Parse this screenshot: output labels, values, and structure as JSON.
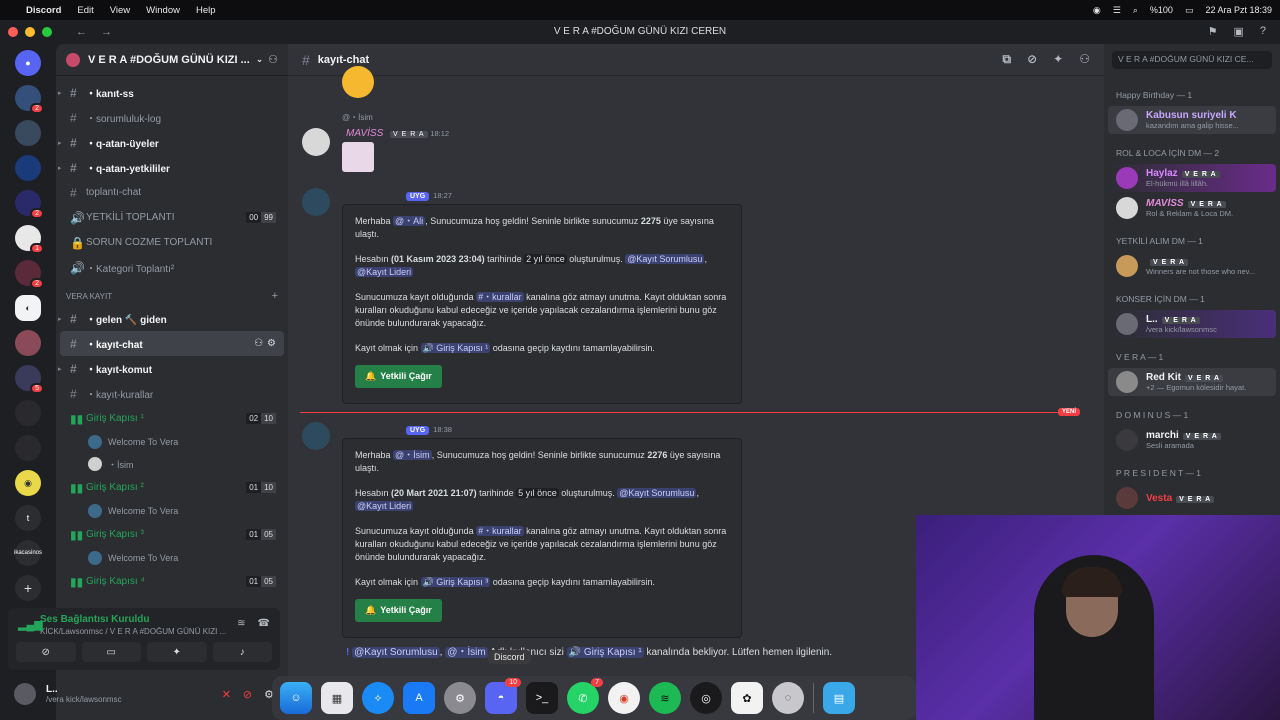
{
  "menubar": {
    "app": "Discord",
    "items": [
      "Edit",
      "View",
      "Window",
      "Help"
    ],
    "battery": "%100",
    "datetime": "22 Ara Pzt  18:39"
  },
  "window": {
    "title": "V E R A #DOĞUM GÜNÜ KIZI CEREN"
  },
  "servers": {
    "badges": [
      "2",
      "1",
      "2",
      "5"
    ],
    "letters": [
      "t",
      "ikacasinos"
    ]
  },
  "sidebar": {
    "server_name": "V E R A #DOĞUM GÜNÜ KIZI ...",
    "channels": [
      {
        "name": "・kanıt-ss"
      },
      {
        "name": "・sorumluluk-log"
      },
      {
        "name": "・q-atan-üyeler"
      },
      {
        "name": "・q-atan-yetkililer"
      },
      {
        "name": "toplantı-chat"
      },
      {
        "name": "YETKİLİ TOPLANTI",
        "count_a": "00",
        "count_b": "99"
      },
      {
        "name": "SORUN COZME TOPLANTI"
      },
      {
        "name": "・Kategori Toplantı²"
      }
    ],
    "category": "VERA KAYIT",
    "reg_channels": [
      {
        "name": "・gelen 🔨 giden"
      },
      {
        "name": "・kayıt-chat"
      },
      {
        "name": "・kayıt-komut"
      },
      {
        "name": "・kayıt-kurallar"
      }
    ],
    "voice": [
      {
        "name": "Giriş Kapısı ¹",
        "count_a": "02",
        "count_b": "10",
        "users": [
          "Welcome To Vera",
          "・İsim"
        ]
      },
      {
        "name": "Giriş Kapısı ²",
        "count_a": "01",
        "count_b": "10",
        "users": [
          "Welcome To Vera"
        ]
      },
      {
        "name": "Giriş Kapısı ³",
        "count_a": "01",
        "count_b": "05",
        "users": [
          "Welcome To Vera"
        ]
      },
      {
        "name": "Giriş Kapısı ⁴",
        "count_a": "01",
        "count_b": "05",
        "users": []
      }
    ],
    "voice_panel": {
      "status": "Ses Bağlantısı Kuruldu",
      "location": "KİCK/Lawsonmsc / V E R A #DOĞUM GÜNÜ KIZI ..."
    },
    "user": {
      "name": "L..",
      "status": "/vera kick/lawsonmsc"
    }
  },
  "chat": {
    "channel": "kayıt-chat",
    "reply_preview": "@・İsim",
    "first_author": "MAVİSS",
    "first_tag": "V E R A",
    "first_time": "18:12",
    "bot_tag": "UYG",
    "messages": [
      {
        "time": "18:27",
        "hello": "Merhaba",
        "mention": "@・Ali",
        "welcome": ", Sunucumuza hoş geldin! Seninle birlikte sunucumuz",
        "count": "2275",
        "count_suffix": "üye sayısına ulaştı.",
        "account_prefix": "Hesabın",
        "account_date": "(01 Kasım 2023 23:04)",
        "account_mid": "tarihinde",
        "account_ago": "2 yıl önce",
        "account_suffix": "oluşturulmuş.",
        "role1": "@Kayıt Sorumlusu",
        "role2": "@Kayıt Lideri",
        "rules_text1": "Sunucumuza kayıt olduğunda",
        "rules_channel": "#・kurallar",
        "rules_text2": "kanalına göz atmayı unutma. Kayıt olduktan sonra kuralları okuduğunu kabul edeceğiz ve içeride yapılacak cezalandırma işlemlerini bunu göz önünde bulundurarak yapacağız.",
        "gate_prefix": "Kayıt olmak için",
        "gate_channel": "🔊 Giriş Kapısı ¹",
        "gate_suffix": "odasına geçip kaydını tamamlayabilirsin.",
        "button": "Yetkili Çağır"
      },
      {
        "time": "18:38",
        "hello": "Merhaba",
        "mention": "@・İsim",
        "welcome": ", Sunucumuza hoş geldin! Seninle birlikte sunucumuz",
        "count": "2276",
        "count_suffix": "üye sayısına ulaştı.",
        "account_prefix": "Hesabın",
        "account_date": "(20 Mart 2021 21:07)",
        "account_mid": "tarihinde",
        "account_ago": "5 yıl önce",
        "account_suffix": "oluşturulmuş.",
        "role1": "@Kayıt Sorumlusu",
        "role2": "@Kayıt Lideri",
        "rules_text1": "Sunucumuza kayıt olduğunda",
        "rules_channel": "#・kurallar",
        "rules_text2": "kanalına göz atmayı unutma. Kayıt olduktan sonra kuralları okuduğunu kabul edeceğiz ve içeride yapılacak cezalandırma işlemlerini bunu göz önünde bulundurarak yapacağız.",
        "gate_prefix": "Kayıt olmak için",
        "gate_channel": "🔊 Giriş Kapısı ³",
        "gate_suffix": "odasına geçip kaydını tamamlayabilirsin.",
        "button": "Yetkili Çağır"
      }
    ],
    "new_label": "YENİ",
    "bottom": {
      "role": "@Kayıt Sorumlusu",
      "mention": "@・İsim",
      "text1": "Adlı kullanıcı sizi",
      "channel": "🔊 Giriş Kapısı ¹",
      "text2": "kanalında bekliyor. Lütfen hemen ilgilenin."
    }
  },
  "members": {
    "search_placeholder": "V E R A #DOĞUM GÜNÜ KIZI CE...",
    "groups": [
      {
        "title": "Happy Birthday — 1",
        "members": [
          {
            "name": "Kabusun suriyeli K",
            "status": "kazandım ama galip hisse..."
          }
        ]
      },
      {
        "title": "ROL & LOCA İÇİN DM — 2",
        "members": [
          {
            "name": "Haylaz",
            "badge": "V E R A",
            "status": "El-hükmü illâ lillâh."
          },
          {
            "name": "MAVİSS",
            "badge": "V E R A",
            "status": "Rol & Reklam & Loca DM."
          }
        ]
      },
      {
        "title": "YETKİLİ ALIM DM — 1",
        "members": [
          {
            "name": "",
            "badge": "V E R A",
            "status": "Winners are not those who nev..."
          }
        ]
      },
      {
        "title": "KONSER İÇİN DM — 1",
        "members": [
          {
            "name": "L..",
            "badge": "V E R A",
            "status": "/vera kick/lawsonmsc"
          }
        ]
      },
      {
        "title": "V E R A — 1",
        "members": [
          {
            "name": "Red Kit",
            "badge": "V E R A",
            "status": "+2 — Egomun kölesidir hayat."
          }
        ]
      },
      {
        "title": "D O M I N U S — 1",
        "members": [
          {
            "name": "marchi",
            "badge": "V E R A",
            "status": "Sesli aramada"
          }
        ]
      },
      {
        "title": "P R E S I D E N T — 1",
        "members": [
          {
            "name": "Vesta",
            "badge": "V E R A",
            "status": ""
          }
        ]
      }
    ]
  },
  "dock": {
    "tooltip": "Discord",
    "discord_badge": "10",
    "whatsapp_badge": "7"
  }
}
